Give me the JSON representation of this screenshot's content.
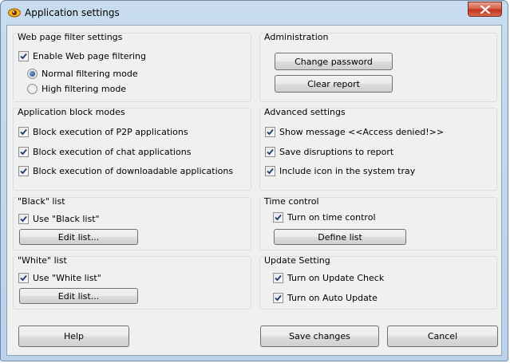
{
  "window": {
    "title": "Application settings"
  },
  "web_filter": {
    "title": "Web page filter settings",
    "enable_label": "Enable Web page filtering",
    "normal_label": "Normal filtering mode",
    "high_label": "High filtering mode"
  },
  "administration": {
    "title": "Administration",
    "change_password": "Change password",
    "clear_report": "Clear report"
  },
  "block_modes": {
    "title": "Application block modes",
    "p2p": "Block execution of P2P applications",
    "chat": "Block execution of chat applications",
    "downloadable": "Block execution of downloadable applications"
  },
  "advanced": {
    "title": "Advanced settings",
    "show_message": "Show message <<Access denied!>>",
    "save_disruptions": "Save disruptions to report",
    "include_icon": "Include icon in the system tray"
  },
  "black_list": {
    "title": "\"Black\" list",
    "use_label": "Use \"Black list\"",
    "edit": "Edit list..."
  },
  "time_control": {
    "title": "Time control",
    "turn_on": "Turn on time control",
    "define": "Define list"
  },
  "white_list": {
    "title": "\"White\" list",
    "use_label": "Use \"White list\"",
    "edit": "Edit list..."
  },
  "update": {
    "title": "Update Setting",
    "check": "Turn on Update Check",
    "auto": "Turn on Auto Update"
  },
  "footer": {
    "help": "Help",
    "save": "Save changes",
    "cancel": "Cancel"
  },
  "state": {
    "enable_filtering": true,
    "filter_mode": "Normal filtering mode",
    "block_p2p": true,
    "block_chat": true,
    "block_downloadable": true,
    "show_message": true,
    "save_disruptions": true,
    "include_icon": true,
    "use_black_list": true,
    "time_control": true,
    "use_white_list": true,
    "update_check": true,
    "auto_update": true
  },
  "colors": {
    "title_bar": "#c9dcef",
    "dialog_bg": "#f0f0f0",
    "close_button": "#c2341d",
    "check_mark": "#1e3a6e"
  }
}
